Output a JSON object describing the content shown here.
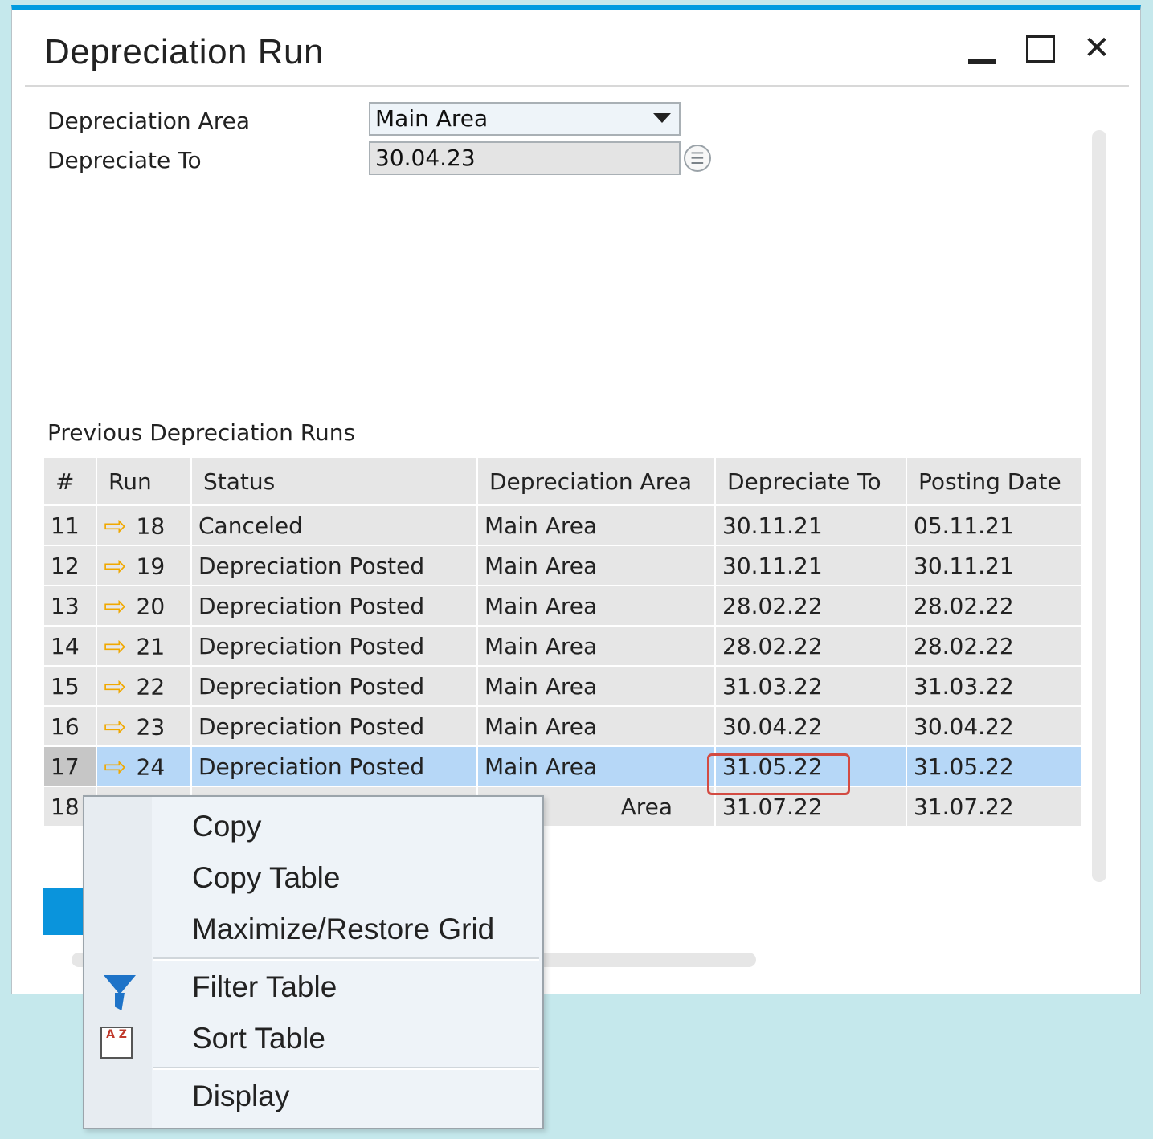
{
  "window": {
    "title": "Depreciation Run",
    "minimize_symbol": "",
    "close_symbol": "✕"
  },
  "form": {
    "area_label": "Depreciation Area",
    "area_value": "Main Area",
    "depreciate_to_label": "Depreciate To",
    "depreciate_to_value": "30.04.23",
    "calendar_symbol": "☰"
  },
  "grid": {
    "section_label": "Previous Depreciation Runs",
    "columns": [
      "#",
      "Run",
      "Status",
      "Depreciation Area",
      "Depreciate To",
      "Posting Date"
    ],
    "rows": [
      {
        "num": "11",
        "run": "18",
        "status": "Canceled",
        "area": "Main Area",
        "depr_to": "30.11.21",
        "posting": "05.11.21"
      },
      {
        "num": "12",
        "run": "19",
        "status": "Depreciation Posted",
        "area": "Main Area",
        "depr_to": "30.11.21",
        "posting": "30.11.21"
      },
      {
        "num": "13",
        "run": "20",
        "status": "Depreciation Posted",
        "area": "Main Area",
        "depr_to": "28.02.22",
        "posting": "28.02.22"
      },
      {
        "num": "14",
        "run": "21",
        "status": "Depreciation Posted",
        "area": "Main Area",
        "depr_to": "28.02.22",
        "posting": "28.02.22"
      },
      {
        "num": "15",
        "run": "22",
        "status": "Depreciation Posted",
        "area": "Main Area",
        "depr_to": "31.03.22",
        "posting": "31.03.22"
      },
      {
        "num": "16",
        "run": "23",
        "status": "Depreciation Posted",
        "area": "Main Area",
        "depr_to": "30.04.22",
        "posting": "30.04.22"
      },
      {
        "num": "17",
        "run": "24",
        "status": "Depreciation Posted",
        "area": "Main Area",
        "depr_to": "31.05.22",
        "posting": "31.05.22"
      },
      {
        "num": "18",
        "run": "",
        "status": "",
        "area": "Area",
        "depr_to": "31.07.22",
        "posting": "31.07.22"
      }
    ],
    "selected_row": "17",
    "link_arrow": "⇨"
  },
  "context_menu": {
    "items": [
      "Copy",
      "Copy Table",
      "Maximize/Restore Grid",
      "Filter Table",
      "Sort Table",
      "Display"
    ],
    "sort_icon_text": "A Z"
  },
  "colors": {
    "accent": "#009be0",
    "selection": "#b6d7f7",
    "highlight_border": "#d34b42",
    "link_arrow": "#f0a800"
  }
}
